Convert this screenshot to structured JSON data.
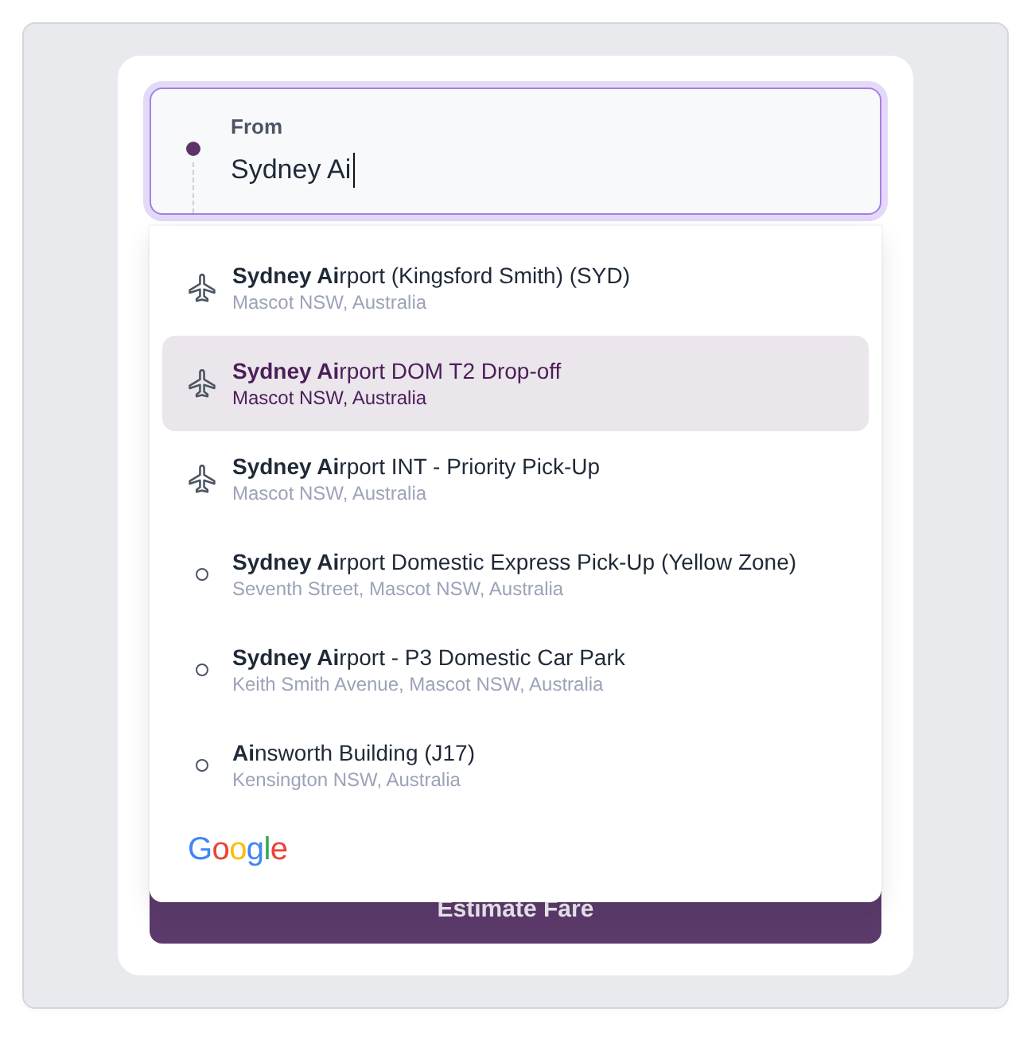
{
  "form": {
    "field": {
      "label": "From",
      "value": "Sydney Ai",
      "focused": true
    },
    "suggestions": [
      {
        "kind": "airport",
        "title": "**Sydney Ai**rport (Kingsford Smith) (SYD)",
        "subtitle": "Mascot NSW, Australia",
        "selected": false
      },
      {
        "kind": "airport",
        "title": "**Sydney Ai**rport DOM T2 Drop-off",
        "subtitle": "Mascot NSW, Australia",
        "selected": true
      },
      {
        "kind": "airport",
        "title": "**Sydney Ai**rport INT - Priority Pick-Up",
        "subtitle": "Mascot NSW, Australia",
        "selected": false
      },
      {
        "kind": "place",
        "title": "**Sydney Ai**rport Domestic Express Pick-Up (Yellow Zone)",
        "subtitle": "Seventh Street, Mascot NSW, Australia",
        "selected": false
      },
      {
        "kind": "place",
        "title": "**Sydney Ai**rport - P3 Domestic Car Park",
        "subtitle": "Keith Smith Avenue, Mascot NSW, Australia",
        "selected": false
      },
      {
        "kind": "place",
        "title": "**Ai**nsworth Building (J17)",
        "subtitle": "Kensington NSW, Australia",
        "selected": false
      }
    ],
    "attribution": "Google",
    "button": {
      "label": "Estimate Fare"
    }
  }
}
